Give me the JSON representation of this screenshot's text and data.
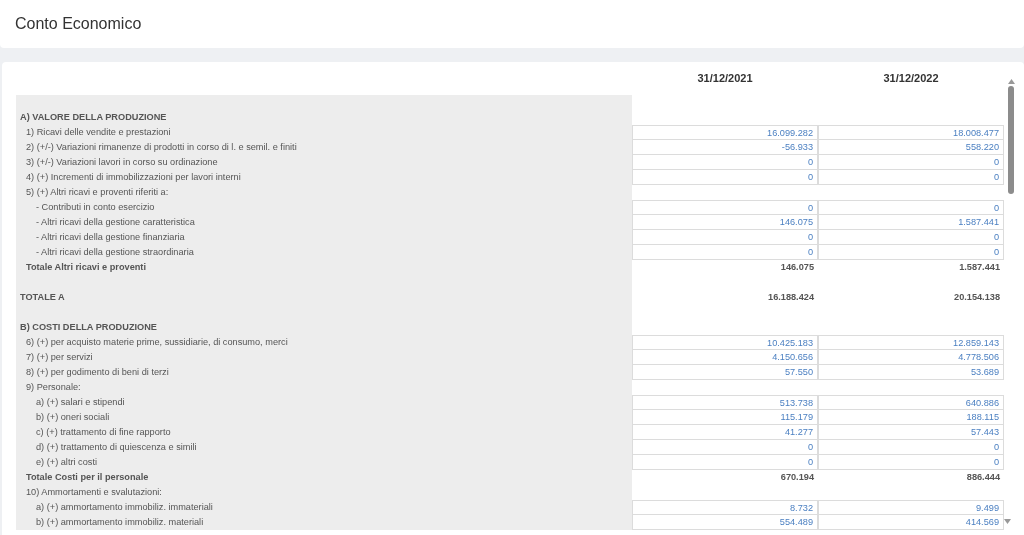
{
  "page": {
    "title": "Conto Economico"
  },
  "columns": [
    "31/12/2021",
    "31/12/2022"
  ],
  "rows": [
    {
      "kind": "section",
      "label": "A) VALORE DELLA PRODUZIONE",
      "children": [
        {
          "kind": "item",
          "label": "1) Ricavi delle vendite e prestazioni",
          "values": [
            "16.099.282",
            "18.008.477"
          ]
        },
        {
          "kind": "item",
          "label": "2) (+/-) Variazioni rimanenze di prodotti in corso di l. e semil. e finiti",
          "values": [
            "-56.933",
            "558.220"
          ]
        },
        {
          "kind": "item",
          "label": "3) (+/-) Variazioni lavori in corso su ordinazione",
          "values": [
            "0",
            "0"
          ]
        },
        {
          "kind": "item",
          "label": "4) (+) Incrementi di immobilizzazioni per lavori interni",
          "values": [
            "0",
            "0"
          ]
        },
        {
          "kind": "group",
          "label": "5) (+) Altri ricavi e proventi riferiti a:",
          "children": [
            {
              "kind": "item",
              "label": "- Contributi in conto esercizio",
              "values": [
                "0",
                "0"
              ]
            },
            {
              "kind": "item",
              "label": "- Altri ricavi della gestione caratteristica",
              "values": [
                "146.075",
                "1.587.441"
              ]
            },
            {
              "kind": "item",
              "label": "- Altri ricavi della gestione finanziaria",
              "values": [
                "0",
                "0"
              ]
            },
            {
              "kind": "item",
              "label": "- Altri ricavi della gestione straordinaria",
              "values": [
                "0",
                "0"
              ]
            }
          ]
        },
        {
          "kind": "total",
          "label": "Totale Altri ricavi e proventi",
          "values": [
            "146.075",
            "1.587.441"
          ]
        }
      ]
    },
    {
      "kind": "grand_total",
      "label": "TOTALE A",
      "values": [
        "16.188.424",
        "20.154.138"
      ]
    },
    {
      "kind": "section",
      "label": "B) COSTI DELLA PRODUZIONE",
      "children": [
        {
          "kind": "item",
          "label": "6) (+) per acquisto materie prime, sussidiarie, di consumo, merci",
          "values": [
            "10.425.183",
            "12.859.143"
          ]
        },
        {
          "kind": "item",
          "label": "7) (+) per servizi",
          "values": [
            "4.150.656",
            "4.778.506"
          ]
        },
        {
          "kind": "item",
          "label": "8) (+) per godimento di beni di terzi",
          "values": [
            "57.550",
            "53.689"
          ]
        },
        {
          "kind": "group",
          "label": "9) Personale:",
          "children": [
            {
              "kind": "item",
              "label": "a) (+) salari e stipendi",
              "values": [
                "513.738",
                "640.886"
              ]
            },
            {
              "kind": "item",
              "label": "b) (+) oneri sociali",
              "values": [
                "115.179",
                "188.115"
              ]
            },
            {
              "kind": "item",
              "label": "c) (+) trattamento di fine rapporto",
              "values": [
                "41.277",
                "57.443"
              ]
            },
            {
              "kind": "item",
              "label": "d) (+) trattamento di quiescenza e simili",
              "values": [
                "0",
                "0"
              ]
            },
            {
              "kind": "item",
              "label": "e) (+) altri costi",
              "values": [
                "0",
                "0"
              ]
            }
          ]
        },
        {
          "kind": "total",
          "label": "Totale Costi per il personale",
          "values": [
            "670.194",
            "886.444"
          ]
        },
        {
          "kind": "group",
          "label": "10) Ammortamenti e svalutazioni:",
          "children": [
            {
              "kind": "item",
              "label": "a) (+) ammortamento immobiliz. immateriali",
              "values": [
                "8.732",
                "9.499"
              ]
            },
            {
              "kind": "item",
              "label": "b) (+) ammortamento immobiliz. materiali",
              "values": [
                "554.489",
                "414.569"
              ]
            }
          ]
        }
      ]
    }
  ]
}
